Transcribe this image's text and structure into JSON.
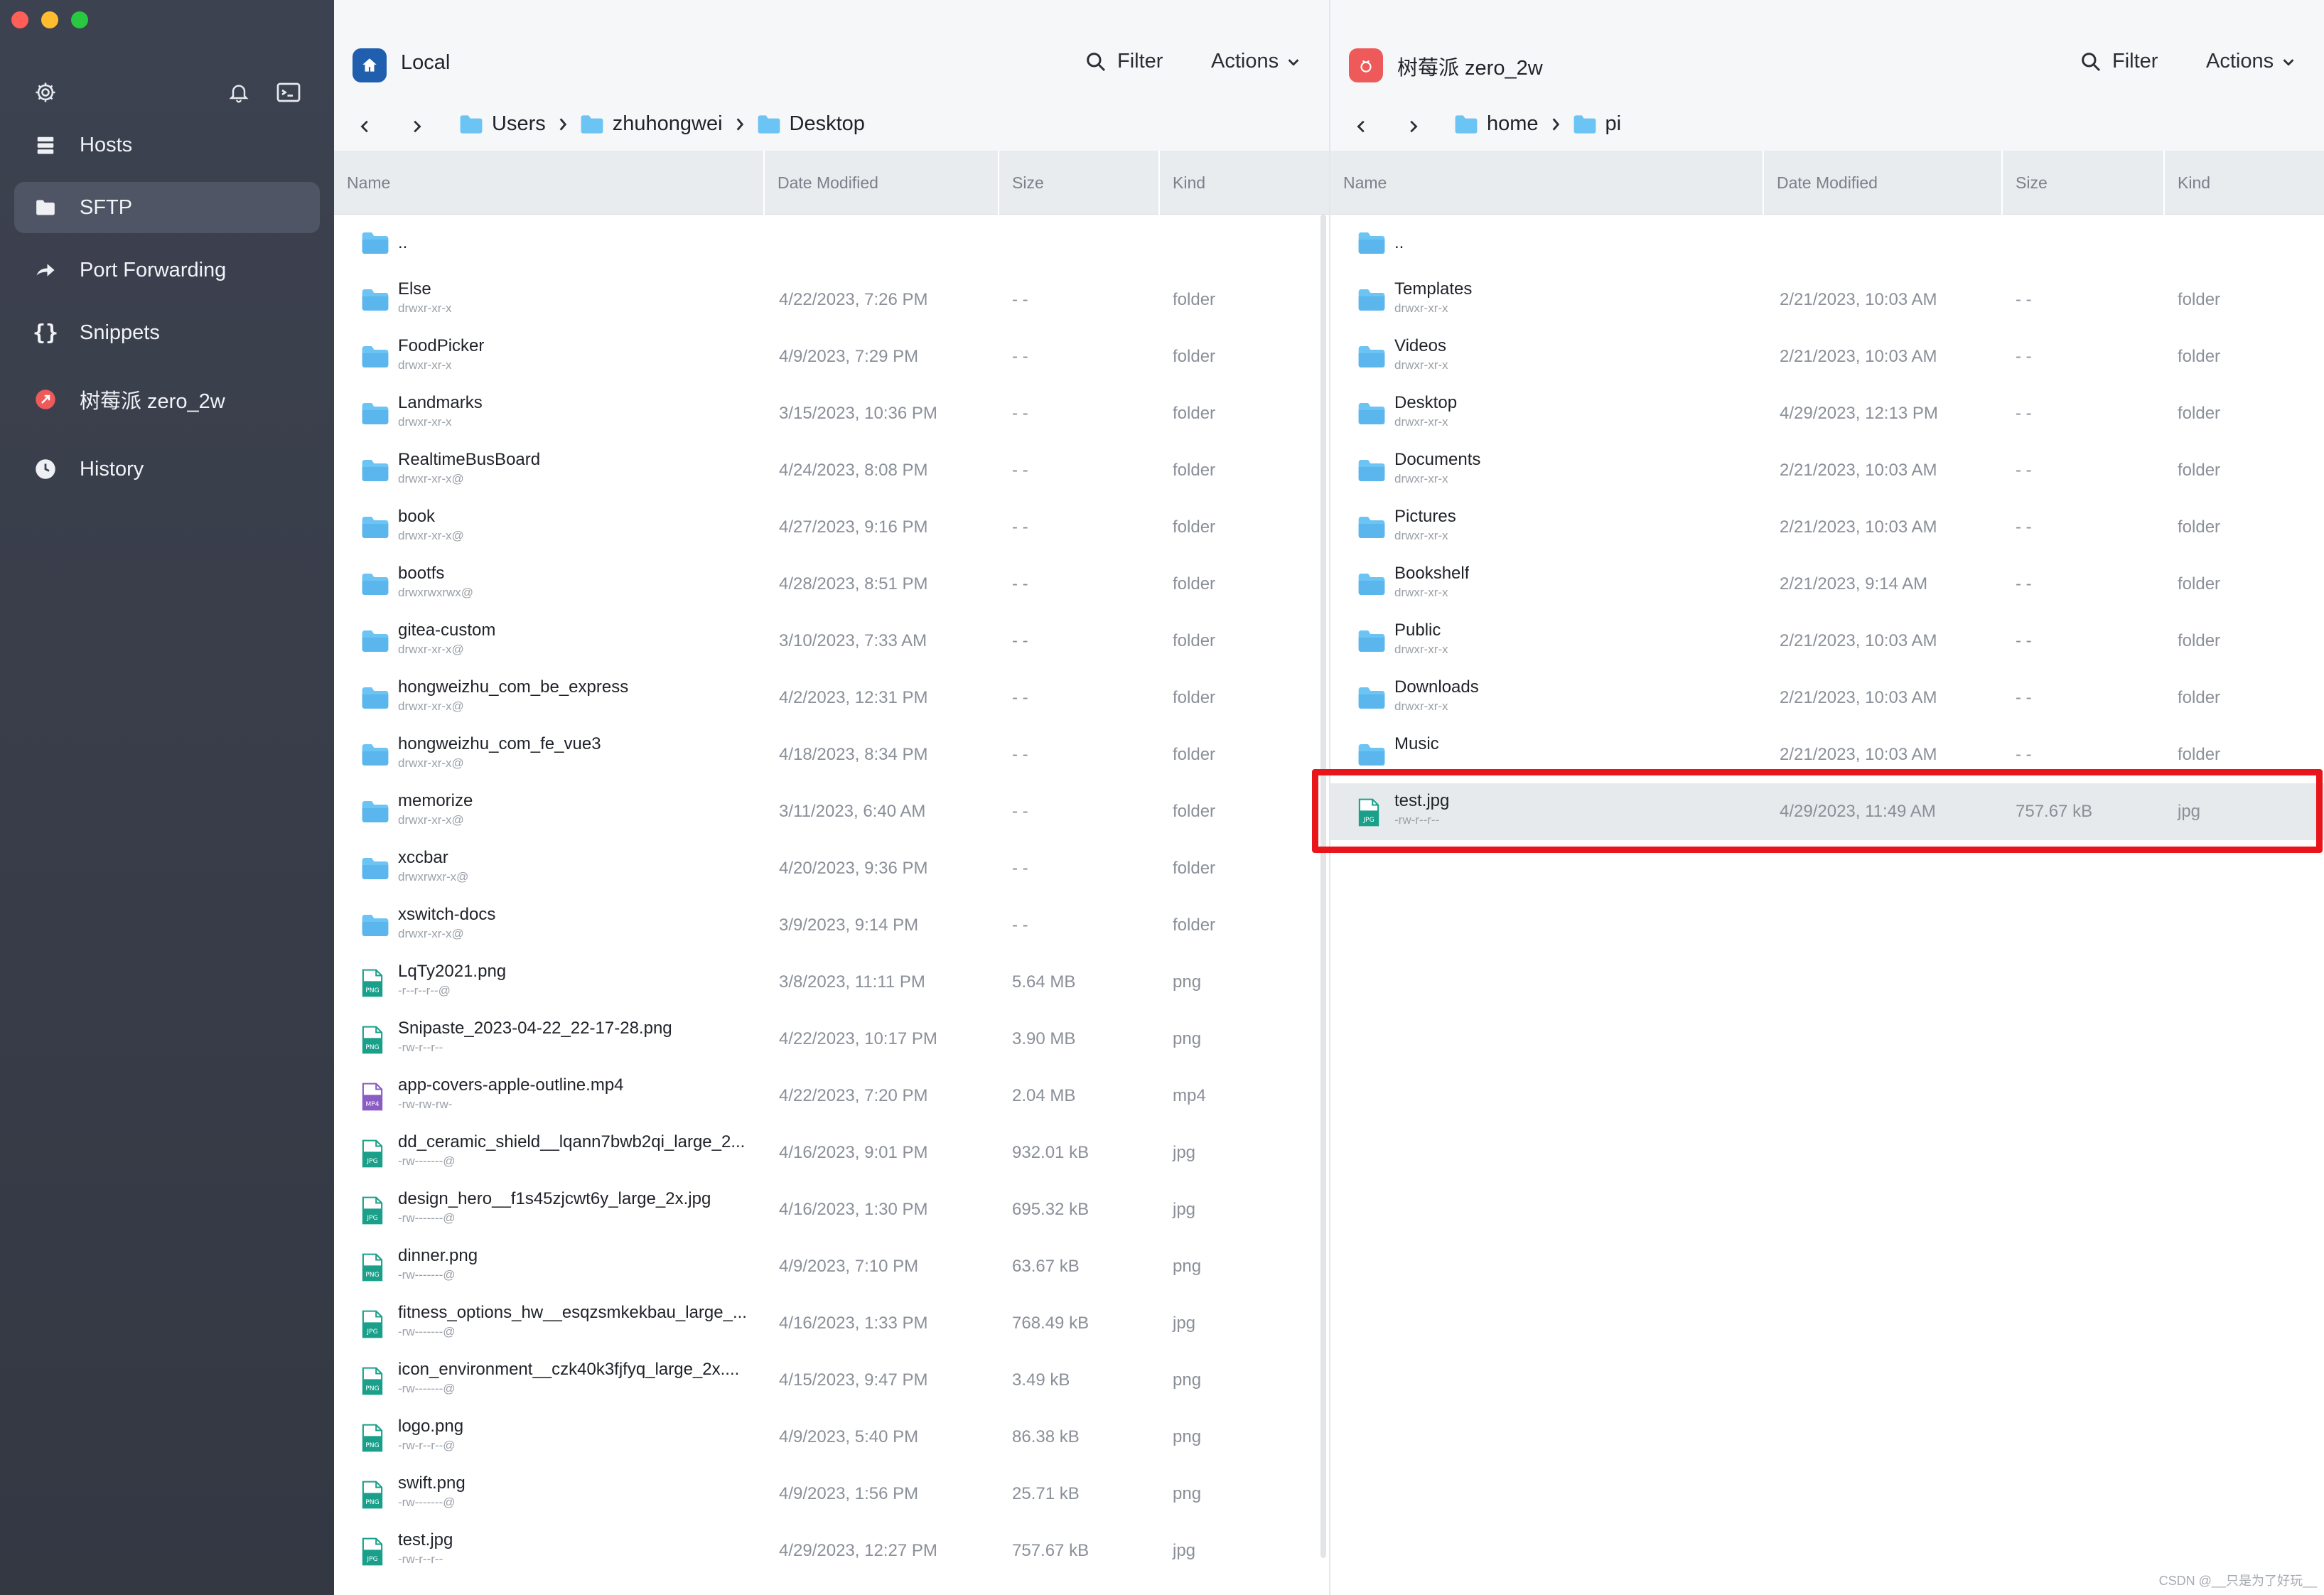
{
  "sidebar": {
    "items": [
      {
        "label": "Hosts",
        "icon": "hosts-icon"
      },
      {
        "label": "SFTP",
        "icon": "folder-icon"
      },
      {
        "label": "Port Forwarding",
        "icon": "forward-arrow-icon"
      },
      {
        "label": "Snippets",
        "icon": "braces-icon"
      },
      {
        "label": "树莓派 zero_2w",
        "icon": "raspberry-pi-icon"
      },
      {
        "label": "History",
        "icon": "clock-icon"
      }
    ],
    "active_item": "SFTP"
  },
  "local": {
    "title": "Local",
    "filter_label": "Filter",
    "actions_label": "Actions",
    "breadcrumbs": [
      "Users",
      "zhuhongwei",
      "Desktop"
    ],
    "columns": {
      "name": "Name",
      "date": "Date Modified",
      "size": "Size",
      "kind": "Kind"
    },
    "rows": [
      {
        "name": "..",
        "perm": "",
        "date": "",
        "size": "",
        "kind": "",
        "type": "folder"
      },
      {
        "name": "Else",
        "perm": "drwxr-xr-x",
        "date": "4/22/2023, 7:26 PM",
        "size": "- -",
        "kind": "folder",
        "type": "folder"
      },
      {
        "name": "FoodPicker",
        "perm": "drwxr-xr-x",
        "date": "4/9/2023, 7:29 PM",
        "size": "- -",
        "kind": "folder",
        "type": "folder"
      },
      {
        "name": "Landmarks",
        "perm": "drwxr-xr-x",
        "date": "3/15/2023, 10:36 PM",
        "size": "- -",
        "kind": "folder",
        "type": "folder"
      },
      {
        "name": "RealtimeBusBoard",
        "perm": "drwxr-xr-x@",
        "date": "4/24/2023, 8:08 PM",
        "size": "- -",
        "kind": "folder",
        "type": "folder"
      },
      {
        "name": "book",
        "perm": "drwxr-xr-x@",
        "date": "4/27/2023, 9:16 PM",
        "size": "- -",
        "kind": "folder",
        "type": "folder"
      },
      {
        "name": "bootfs",
        "perm": "drwxrwxrwx@",
        "date": "4/28/2023, 8:51 PM",
        "size": "- -",
        "kind": "folder",
        "type": "folder"
      },
      {
        "name": "gitea-custom",
        "perm": "drwxr-xr-x@",
        "date": "3/10/2023, 7:33 AM",
        "size": "- -",
        "kind": "folder",
        "type": "folder"
      },
      {
        "name": "hongweizhu_com_be_express",
        "perm": "drwxr-xr-x@",
        "date": "4/2/2023, 12:31 PM",
        "size": "- -",
        "kind": "folder",
        "type": "folder"
      },
      {
        "name": "hongweizhu_com_fe_vue3",
        "perm": "drwxr-xr-x@",
        "date": "4/18/2023, 8:34 PM",
        "size": "- -",
        "kind": "folder",
        "type": "folder"
      },
      {
        "name": "memorize",
        "perm": "drwxr-xr-x@",
        "date": "3/11/2023, 6:40 AM",
        "size": "- -",
        "kind": "folder",
        "type": "folder"
      },
      {
        "name": "xccbar",
        "perm": "drwxrwxr-x@",
        "date": "4/20/2023, 9:36 PM",
        "size": "- -",
        "kind": "folder",
        "type": "folder"
      },
      {
        "name": "xswitch-docs",
        "perm": "drwxr-xr-x@",
        "date": "3/9/2023, 9:14 PM",
        "size": "- -",
        "kind": "folder",
        "type": "folder"
      },
      {
        "name": "LqTy2021.png",
        "perm": "-r--r--r--@",
        "date": "3/8/2023, 11:11 PM",
        "size": "5.64 MB",
        "kind": "png",
        "type": "png"
      },
      {
        "name": "Snipaste_2023-04-22_22-17-28.png",
        "perm": "-rw-r--r--",
        "date": "4/22/2023, 10:17 PM",
        "size": "3.90 MB",
        "kind": "png",
        "type": "png"
      },
      {
        "name": "app-covers-apple-outline.mp4",
        "perm": "-rw-rw-rw-",
        "date": "4/22/2023, 7:20 PM",
        "size": "2.04 MB",
        "kind": "mp4",
        "type": "mp4"
      },
      {
        "name": "dd_ceramic_shield__lqann7bwb2qi_large_2...",
        "perm": "-rw-------@",
        "date": "4/16/2023, 9:01 PM",
        "size": "932.01 kB",
        "kind": "jpg",
        "type": "jpg"
      },
      {
        "name": "design_hero__f1s45zjcwt6y_large_2x.jpg",
        "perm": "-rw-------@",
        "date": "4/16/2023, 1:30 PM",
        "size": "695.32 kB",
        "kind": "jpg",
        "type": "jpg"
      },
      {
        "name": "dinner.png",
        "perm": "-rw-------@",
        "date": "4/9/2023, 7:10 PM",
        "size": "63.67 kB",
        "kind": "png",
        "type": "png"
      },
      {
        "name": "fitness_options_hw__esqzsmkekbau_large_...",
        "perm": "-rw-------@",
        "date": "4/16/2023, 1:33 PM",
        "size": "768.49 kB",
        "kind": "jpg",
        "type": "jpg"
      },
      {
        "name": "icon_environment__czk40k3fjfyq_large_2x....",
        "perm": "-rw-------@",
        "date": "4/15/2023, 9:47 PM",
        "size": "3.49 kB",
        "kind": "png",
        "type": "png"
      },
      {
        "name": "logo.png",
        "perm": "-rw-r--r--@",
        "date": "4/9/2023, 5:40 PM",
        "size": "86.38 kB",
        "kind": "png",
        "type": "png"
      },
      {
        "name": "swift.png",
        "perm": "-rw-------@",
        "date": "4/9/2023, 1:56 PM",
        "size": "25.71 kB",
        "kind": "png",
        "type": "png"
      },
      {
        "name": "test.jpg",
        "perm": "-rw-r--r--",
        "date": "4/29/2023, 12:27 PM",
        "size": "757.67 kB",
        "kind": "jpg",
        "type": "jpg"
      }
    ]
  },
  "remote": {
    "title": "树莓派 zero_2w",
    "filter_label": "Filter",
    "actions_label": "Actions",
    "breadcrumbs": [
      "home",
      "pi"
    ],
    "columns": {
      "name": "Name",
      "date": "Date Modified",
      "size": "Size",
      "kind": "Kind"
    },
    "rows": [
      {
        "name": "..",
        "perm": "",
        "date": "",
        "size": "",
        "kind": "",
        "type": "folder"
      },
      {
        "name": "Templates",
        "perm": "drwxr-xr-x",
        "date": "2/21/2023, 10:03 AM",
        "size": "- -",
        "kind": "folder",
        "type": "folder"
      },
      {
        "name": "Videos",
        "perm": "drwxr-xr-x",
        "date": "2/21/2023, 10:03 AM",
        "size": "- -",
        "kind": "folder",
        "type": "folder"
      },
      {
        "name": "Desktop",
        "perm": "drwxr-xr-x",
        "date": "4/29/2023, 12:13 PM",
        "size": "- -",
        "kind": "folder",
        "type": "folder"
      },
      {
        "name": "Documents",
        "perm": "drwxr-xr-x",
        "date": "2/21/2023, 10:03 AM",
        "size": "- -",
        "kind": "folder",
        "type": "folder"
      },
      {
        "name": "Pictures",
        "perm": "drwxr-xr-x",
        "date": "2/21/2023, 10:03 AM",
        "size": "- -",
        "kind": "folder",
        "type": "folder"
      },
      {
        "name": "Bookshelf",
        "perm": "drwxr-xr-x",
        "date": "2/21/2023, 9:14 AM",
        "size": "- -",
        "kind": "folder",
        "type": "folder"
      },
      {
        "name": "Public",
        "perm": "drwxr-xr-x",
        "date": "2/21/2023, 10:03 AM",
        "size": "- -",
        "kind": "folder",
        "type": "folder"
      },
      {
        "name": "Downloads",
        "perm": "drwxr-xr-x",
        "date": "2/21/2023, 10:03 AM",
        "size": "- -",
        "kind": "folder",
        "type": "folder"
      },
      {
        "name": "Music",
        "perm": "",
        "date": "2/21/2023, 10:03 AM",
        "size": "- -",
        "kind": "folder",
        "type": "folder"
      },
      {
        "name": "test.jpg",
        "perm": "-rw-r--r--",
        "date": "4/29/2023, 11:49 AM",
        "size": "757.67 kB",
        "kind": "jpg",
        "type": "jpg",
        "selected": true
      }
    ]
  },
  "watermark": "CSDN @__只是为了好玩__",
  "colors": {
    "sidebar_bg": "#3d4250",
    "folder": "#6cc4f5",
    "png_jpg_icon": "#1aa08a",
    "mp4_icon": "#8a5cc4",
    "remote_badge": "#ee5a5a",
    "local_badge": "#1f5fae",
    "highlight": "#e8161b"
  }
}
